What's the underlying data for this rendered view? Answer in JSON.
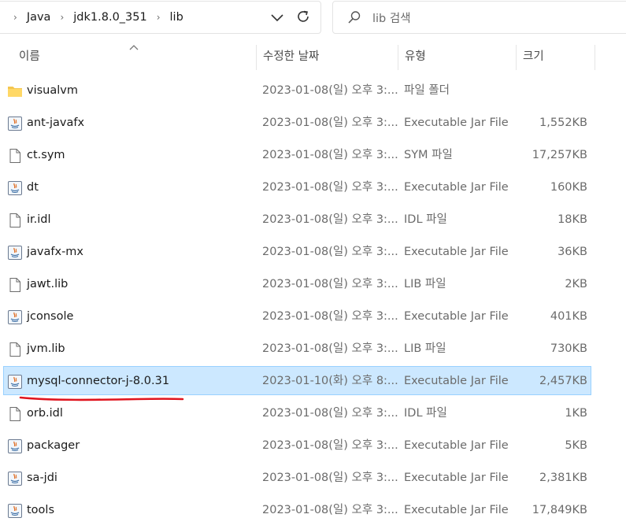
{
  "breadcrumb": [
    "Java",
    "jdk1.8.0_351",
    "lib"
  ],
  "search": {
    "placeholder": "lib 검색"
  },
  "columns": {
    "name": "이름",
    "date": "수정한 날짜",
    "type": "유형",
    "size": "크기"
  },
  "files": [
    {
      "name": "visualvm",
      "date": "2023-01-08(일) 오후 3:...",
      "type": "파일 폴더",
      "size": "",
      "icon": "folder-icon"
    },
    {
      "name": "ant-javafx",
      "date": "2023-01-08(일) 오후 3:...",
      "type": "Executable Jar File",
      "size": "1,552KB",
      "icon": "jar-file-icon"
    },
    {
      "name": "ct.sym",
      "date": "2023-01-08(일) 오후 3:...",
      "type": "SYM 파일",
      "size": "17,257KB",
      "icon": "file-icon"
    },
    {
      "name": "dt",
      "date": "2023-01-08(일) 오후 3:...",
      "type": "Executable Jar File",
      "size": "160KB",
      "icon": "jar-file-icon"
    },
    {
      "name": "ir.idl",
      "date": "2023-01-08(일) 오후 3:...",
      "type": "IDL 파일",
      "size": "18KB",
      "icon": "file-icon"
    },
    {
      "name": "javafx-mx",
      "date": "2023-01-08(일) 오후 3:...",
      "type": "Executable Jar File",
      "size": "36KB",
      "icon": "jar-file-icon"
    },
    {
      "name": "jawt.lib",
      "date": "2023-01-08(일) 오후 3:...",
      "type": "LIB 파일",
      "size": "2KB",
      "icon": "file-icon"
    },
    {
      "name": "jconsole",
      "date": "2023-01-08(일) 오후 3:...",
      "type": "Executable Jar File",
      "size": "401KB",
      "icon": "jar-file-icon"
    },
    {
      "name": "jvm.lib",
      "date": "2023-01-08(일) 오후 3:...",
      "type": "LIB 파일",
      "size": "730KB",
      "icon": "file-icon"
    },
    {
      "name": "mysql-connector-j-8.0.31",
      "date": "2023-01-10(화) 오후 8:...",
      "type": "Executable Jar File",
      "size": "2,457KB",
      "icon": "jar-file-icon",
      "selected": true
    },
    {
      "name": "orb.idl",
      "date": "2023-01-08(일) 오후 3:...",
      "type": "IDL 파일",
      "size": "1KB",
      "icon": "file-icon"
    },
    {
      "name": "packager",
      "date": "2023-01-08(일) 오후 3:...",
      "type": "Executable Jar File",
      "size": "5KB",
      "icon": "jar-file-icon"
    },
    {
      "name": "sa-jdi",
      "date": "2023-01-08(일) 오후 3:...",
      "type": "Executable Jar File",
      "size": "2,381KB",
      "icon": "jar-file-icon"
    },
    {
      "name": "tools",
      "date": "2023-01-08(일) 오후 3:...",
      "type": "Executable Jar File",
      "size": "17,849KB",
      "icon": "jar-file-icon"
    }
  ],
  "colors": {
    "selection_bg": "#cce8ff",
    "selection_border": "#99d1ff",
    "annotation": "#e0141e"
  }
}
